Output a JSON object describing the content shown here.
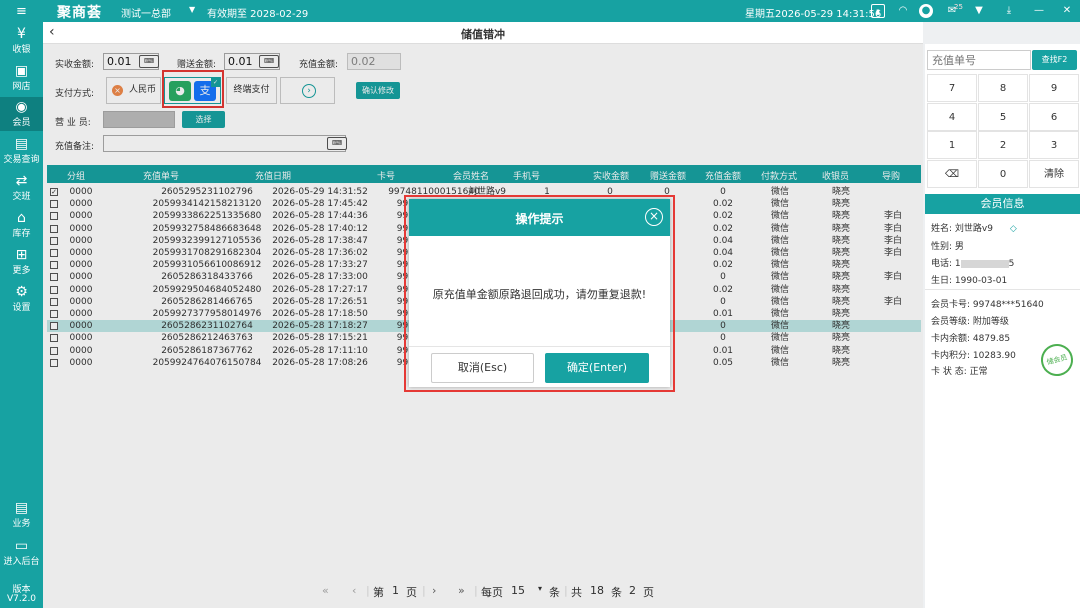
{
  "topbar": {
    "logo": "聚商荟",
    "store": "测试一总部",
    "store_arrow": "▼",
    "expiry": "有效期至 2028-02-29",
    "datetime": "星期五2026-05-29 14:31:56",
    "badge": "25"
  },
  "sidebar": {
    "menu": "≡",
    "items": [
      {
        "icon": "¥",
        "label": "收银"
      },
      {
        "icon": "▣",
        "label": "网店"
      },
      {
        "icon": "◉",
        "label": "会员"
      },
      {
        "icon": "▤",
        "label": "交易查询"
      },
      {
        "icon": "⇄",
        "label": "交班"
      },
      {
        "icon": "⌂",
        "label": "库存"
      },
      {
        "icon": "⊞",
        "label": "更多"
      },
      {
        "icon": "⚙",
        "label": "设置"
      }
    ],
    "bottom": [
      {
        "icon": "▤",
        "label": "业务"
      },
      {
        "icon": "▭",
        "label": "进入后台"
      }
    ],
    "version_label": "版本",
    "version": "V7.2.0"
  },
  "header": {
    "back": "‹",
    "title": "储值错冲"
  },
  "form": {
    "actual_label": "实收金额:",
    "actual_value": "0.01",
    "gift_label": "赠送金额:",
    "gift_value": "0.01",
    "recharge_label": "充值金额:",
    "recharge_value": "0.02",
    "pay_label": "支付方式:",
    "rmb_label": "人民币",
    "terminal_label": "终端支付",
    "confirm_btn": "确认修改",
    "sales_label": "营 业 员:",
    "select_btn": "选择",
    "remark_label": "充值备注:",
    "kb_text": "⌨"
  },
  "table": {
    "headers": [
      "分组",
      "充值单号",
      "充值日期",
      "卡号",
      "会员姓名",
      "手机号",
      "实收金额",
      "赠送金额",
      "充值金额",
      "付款方式",
      "收银员",
      "导购"
    ],
    "rows": [
      {
        "grp": "0000",
        "no": "2605295231102796",
        "date": "2026-05-29 14:31:52",
        "card": "99748110001516​40",
        "name": "刘世路v9",
        "phone": "1",
        "act": "0",
        "gift": "0",
        "amt": "0",
        "pay": "微信",
        "cashier": "晓亮",
        "guide": "",
        "checked": true,
        "sel": false
      },
      {
        "grp": "0000",
        "no": "2059934142158213120",
        "date": "2026-05-28 17:45:42",
        "card": "9974811000151",
        "name": "",
        "phone": "",
        "act": "",
        "gift": "",
        "amt": "0.02",
        "pay": "微信",
        "cashier": "晓亮",
        "guide": "",
        "checked": false,
        "sel": false
      },
      {
        "grp": "0000",
        "no": "2059933862251335680",
        "date": "2026-05-28 17:44:36",
        "card": "9974811000151",
        "name": "",
        "phone": "",
        "act": "",
        "gift": "",
        "amt": "0.02",
        "pay": "微信",
        "cashier": "晓亮",
        "guide": "李白",
        "checked": false,
        "sel": false
      },
      {
        "grp": "0000",
        "no": "2059932758486683648",
        "date": "2026-05-28 17:40:12",
        "card": "9974811000151",
        "name": "",
        "phone": "",
        "act": "",
        "gift": "",
        "amt": "0.02",
        "pay": "微信",
        "cashier": "晓亮",
        "guide": "李白",
        "checked": false,
        "sel": false
      },
      {
        "grp": "0000",
        "no": "2059932399127105536",
        "date": "2026-05-28 17:38:47",
        "card": "9974811000151",
        "name": "",
        "phone": "",
        "act": "",
        "gift": "",
        "amt": "0.04",
        "pay": "微信",
        "cashier": "晓亮",
        "guide": "李白",
        "checked": false,
        "sel": false
      },
      {
        "grp": "0000",
        "no": "2059931708291682304",
        "date": "2026-05-28 17:36:02",
        "card": "9974811000151",
        "name": "",
        "phone": "",
        "act": "",
        "gift": "",
        "amt": "0.04",
        "pay": "微信",
        "cashier": "晓亮",
        "guide": "李白",
        "checked": false,
        "sel": false
      },
      {
        "grp": "0000",
        "no": "2059931056610086912",
        "date": "2026-05-28 17:33:27",
        "card": "9974811000151",
        "name": "",
        "phone": "",
        "act": "",
        "gift": "",
        "amt": "0.02",
        "pay": "微信",
        "cashier": "晓亮",
        "guide": "",
        "checked": false,
        "sel": false
      },
      {
        "grp": "0000",
        "no": "2605286318433766",
        "date": "2026-05-28 17:33:00",
        "card": "9974811000151",
        "name": "",
        "phone": "",
        "act": "",
        "gift": "",
        "amt": "0",
        "pay": "微信",
        "cashier": "晓亮",
        "guide": "李白",
        "checked": false,
        "sel": false
      },
      {
        "grp": "0000",
        "no": "2059929504684052480",
        "date": "2026-05-28 17:27:17",
        "card": "9974811000151",
        "name": "",
        "phone": "",
        "act": "",
        "gift": "",
        "amt": "0.02",
        "pay": "微信",
        "cashier": "晓亮",
        "guide": "",
        "checked": false,
        "sel": false
      },
      {
        "grp": "0000",
        "no": "2605286281466765",
        "date": "2026-05-28 17:26:51",
        "card": "9974811000151",
        "name": "",
        "phone": "",
        "act": "",
        "gift": "",
        "amt": "0",
        "pay": "微信",
        "cashier": "晓亮",
        "guide": "李白",
        "checked": false,
        "sel": false
      },
      {
        "grp": "0000",
        "no": "2059927377958014976",
        "date": "2026-05-28 17:18:50",
        "card": "9974811000151",
        "name": "",
        "phone": "",
        "act": "",
        "gift": "",
        "amt": "0.01",
        "pay": "微信",
        "cashier": "晓亮",
        "guide": "",
        "checked": false,
        "sel": false
      },
      {
        "grp": "0000",
        "no": "2605286231102764",
        "date": "2026-05-28 17:18:27",
        "card": "9974811000151",
        "name": "",
        "phone": "",
        "act": "",
        "gift": "",
        "amt": "0",
        "pay": "微信",
        "cashier": "晓亮",
        "guide": "",
        "checked": false,
        "sel": true
      },
      {
        "grp": "0000",
        "no": "2605286212463763",
        "date": "2026-05-28 17:15:21",
        "card": "9974811000151",
        "name": "",
        "phone": "",
        "act": "",
        "gift": "",
        "amt": "0",
        "pay": "微信",
        "cashier": "晓亮",
        "guide": "",
        "checked": false,
        "sel": false
      },
      {
        "grp": "0000",
        "no": "2605286187367762",
        "date": "2026-05-28 17:11:10",
        "card": "9974811000151",
        "name": "",
        "phone": "",
        "act": "",
        "gift": "",
        "amt": "0.01",
        "pay": "微信",
        "cashier": "晓亮",
        "guide": "",
        "checked": false,
        "sel": false
      },
      {
        "grp": "0000",
        "no": "2059924764076150784",
        "date": "2026-05-28 17:08:26",
        "card": "9974811000151",
        "name": "",
        "phone": "",
        "act": "",
        "gift": "",
        "amt": "0.05",
        "pay": "微信",
        "cashier": "晓亮",
        "guide": "",
        "checked": false,
        "sel": false
      }
    ]
  },
  "pager": {
    "first": "«",
    "prev": "‹",
    "page_prefix": "第",
    "page": "1",
    "page_suffix": "页",
    "next": "›",
    "last": "»",
    "per_prefix": "每页",
    "per_page": "15",
    "per_suffix": "条",
    "total_prefix": "共",
    "total": "18",
    "total_mid": "条",
    "pages": "2",
    "pages_suffix": "页"
  },
  "right": {
    "search_placeholder": "充值单号",
    "search_btn": "查找F2",
    "keys": [
      "7",
      "8",
      "9",
      "4",
      "5",
      "6",
      "1",
      "2",
      "3",
      "⌫",
      "0",
      "清除"
    ],
    "member_title": "会员信息",
    "name_label": "姓名:",
    "name": "刘世路v9",
    "gender_label": "性别:",
    "gender": "男",
    "phone_label": "电话:",
    "phone_a": "1",
    "phone_b": "5",
    "birth_label": "生日:",
    "birth": "1990-03-01",
    "card_label": "会员卡号:",
    "card": "99748***51640",
    "level_label": "会员等级:",
    "level": "附加等级",
    "balance_label": "卡内余额:",
    "balance": "4879.85",
    "points_label": "卡内积分:",
    "points": "10283.90",
    "status_label": "卡 状 态:",
    "status": "正常",
    "stamp": "储会员"
  },
  "modal": {
    "title": "操作提示",
    "close": "×",
    "message": "原充值单金额原路退回成功，请勿重复退款!",
    "cancel": "取消(Esc)",
    "ok": "确定(Enter)"
  },
  "colors": {
    "accent": "#17a2a2",
    "highlight": "#e53935",
    "selected_row": "#bfe8e6"
  }
}
